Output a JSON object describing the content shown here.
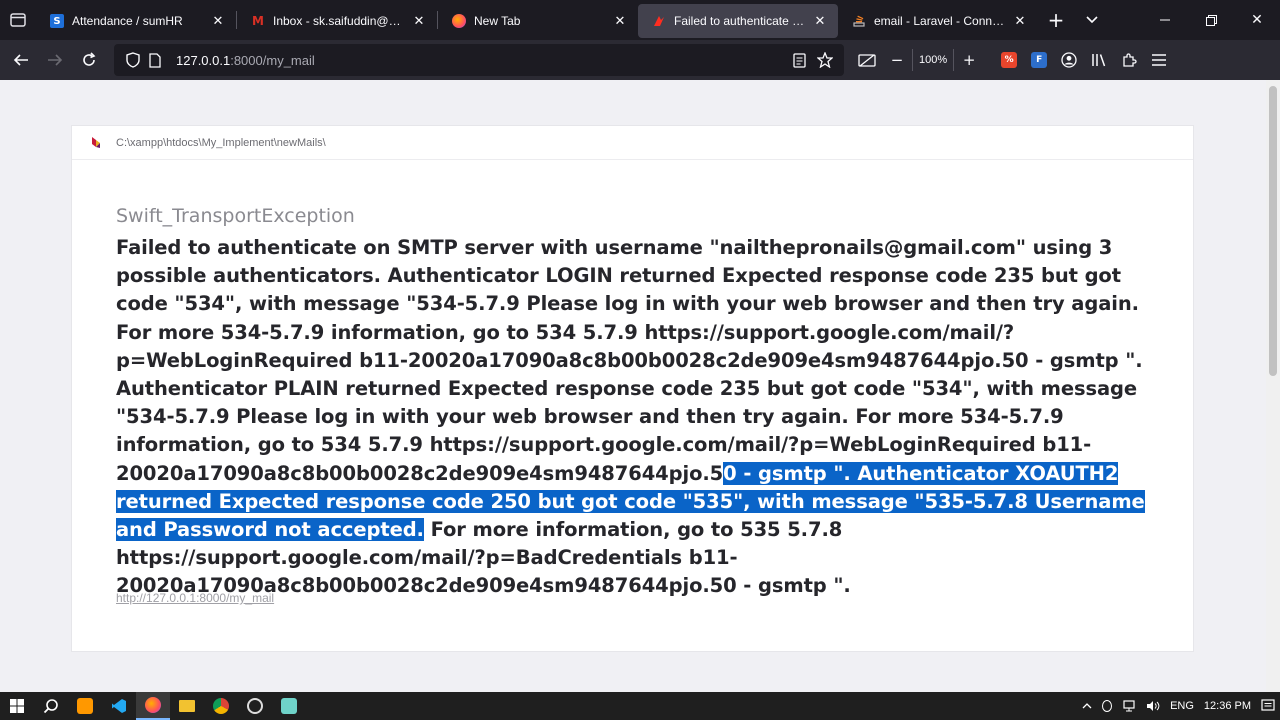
{
  "browser": {
    "tabs": [
      {
        "title": "Attendance / sumHR",
        "favicon_color": "#1e6fd9",
        "favicon_text": "S",
        "active": false
      },
      {
        "title": "Inbox - sk.saifuddin@brainium",
        "favicon_color": "#d93025",
        "favicon_text": "M",
        "active": false
      },
      {
        "title": "New Tab",
        "favicon_color": "#ff6a1a",
        "favicon_text": "",
        "active": false
      },
      {
        "title": "Failed to authenticate on SMTP",
        "favicon_color": "#ff2d20",
        "favicon_text": "",
        "active": true
      },
      {
        "title": "email - Laravel - Connection",
        "favicon_color": "#f48024",
        "favicon_text": "",
        "active": false
      }
    ],
    "new_tab_label": "+",
    "url_host": "127.0.0.1",
    "url_path": ":8000/my_mail",
    "zoom": "100%"
  },
  "page": {
    "root_path": "C:\\xampp\\htdocs\\My_Implement\\newMails\\",
    "exception_class": "Swift_TransportException",
    "message_before_highlight": "Failed to authenticate on SMTP server with username \"nailthepronails@gmail.com\" using 3 possible authenticators. Authenticator LOGIN returned Expected response code 235 but got code \"534\", with message \"534-5.7.9 Please log in with your web browser and then try again. For more 534-5.7.9 information, go to 534 5.7.9 https://support.google.com/mail/?p=WebLoginRequired b11-20020a17090a8c8b00b0028c2de909e4sm9487644pjo.50 - gsmtp \". Authenticator PLAIN returned Expected response code 235 but got code \"534\", with message \"534-5.7.9 Please log in with your web browser and then try again. For more 534-5.7.9 information, go to 534 5.7.9 https://support.google.com/mail/?p=WebLoginRequired b11-20020a17090a8c8b00b0028c2de909e4sm9487644pjo.5",
    "message_highlight": "0 - gsmtp \". Authenticator XOAUTH2 returned Expected response code 250 but got code \"535\", with message \"535-5.7.8 Username and Password not accepted.",
    "message_after_highlight": " For more information, go to 535 5.7.8 https://support.google.com/mail/?p=BadCredentials b11-20020a17090a8c8b00b0028c2de909e4sm9487644pjo.50 - gsmtp \".",
    "request_url": "http://127.0.0.1:8000/my_mail"
  },
  "taskbar": {
    "language": "ENG",
    "time": "12:36 PM"
  },
  "colors": {
    "highlight": "#0a64c8",
    "browser_chrome": "#2b2a33",
    "tabstrip": "#1c1b22"
  }
}
